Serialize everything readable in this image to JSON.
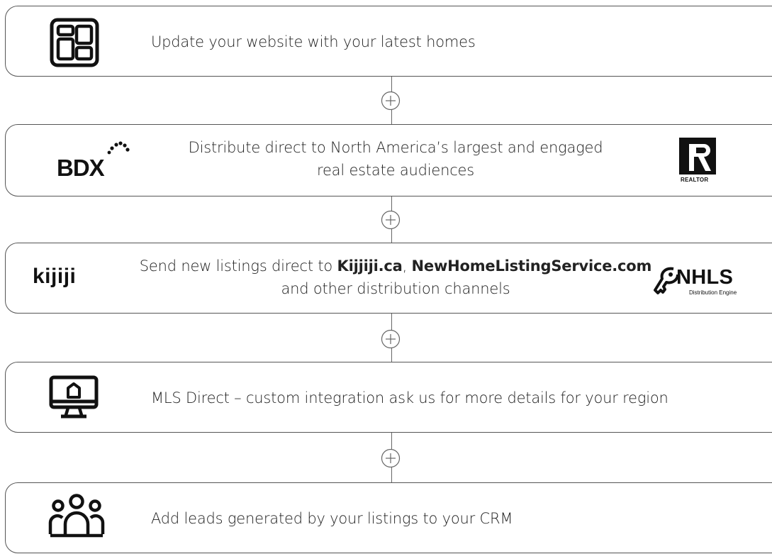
{
  "steps": [
    {
      "text": "Update your website with your latest homes",
      "icon": "website-grid-icon"
    },
    {
      "text_line1": "Distribute direct to North America’s largest and engaged",
      "text_line2": "real estate audiences",
      "left_logo": "BDX",
      "right_logo_label": "REALTOR"
    },
    {
      "text_prefix": "Send new listings direct to ",
      "bold_1": "Kijjiji.ca",
      "comma": ", ",
      "bold_2": "NewHomeListingService.com",
      "text_line2": "and other distribution channels",
      "left_logo": "kijiji",
      "right_logo": "NHLS",
      "right_logo_sub": "Distribution Engine"
    },
    {
      "text": "MLS Direct – custom integration ask us for more details for your region",
      "icon": "monitor-home-icon"
    },
    {
      "text": "Add leads generated by your listings to your CRM",
      "icon": "people-group-icon"
    }
  ],
  "connector_icon": "plus-circle-icon",
  "colors": {
    "border": "#555555",
    "text": "#222222",
    "logo": "#111111"
  }
}
